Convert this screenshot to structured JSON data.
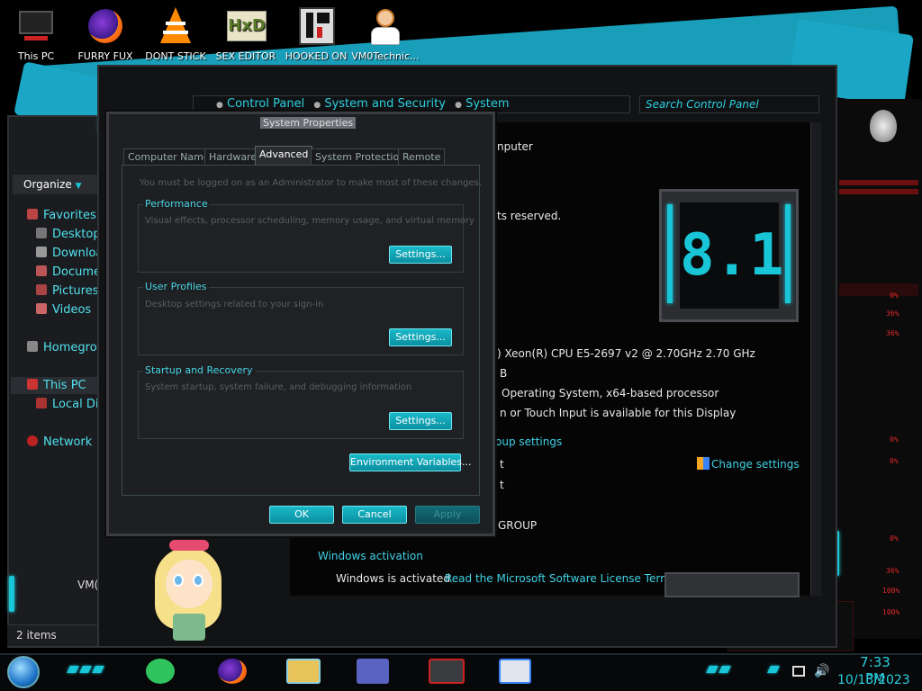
{
  "desktop_icons": [
    {
      "label": "This PC",
      "icon": "this-pc-icon"
    },
    {
      "label": "FURRY FUX",
      "icon": "firefox-icon"
    },
    {
      "label": "DONT STICK",
      "icon": "vlc-icon"
    },
    {
      "label": "SEX EDITOR",
      "icon": "hxd-icon"
    },
    {
      "label": "HOOKED ON",
      "icon": "hooked-on-icon"
    },
    {
      "label": "VM0Technic...",
      "icon": "doctor-avatar-icon"
    }
  ],
  "explorer": {
    "breadcrumb": [
      "Control Panel",
      "System and Security",
      "System"
    ],
    "search_placeholder": "Search Control Panel",
    "organize_label": "Organize",
    "nav": {
      "favorites": "Favorites",
      "desktop": "Desktop",
      "downloads": "Downloac",
      "documents": "Documer",
      "pictures": "Pictures",
      "videos": "Videos",
      "homegroup": "Homegroup",
      "this_pc": "This PC",
      "local_disk": "Local Dis",
      "network": "Network"
    },
    "status_items": "2 items",
    "vm_label": "VM("
  },
  "system_info": {
    "line_computer": "nputer",
    "line_rights": "ts reserved.",
    "windows_version": "8.1",
    "processor": ") Xeon(R) CPU E5-2697 v2 @ 2.70GHz   2.70 GHz",
    "memory_suffix": "B",
    "system_type": "Operating System, x64-based processor",
    "pen_touch": "n or Touch Input is available for this Display",
    "section_group": "oup settings",
    "change_settings": "Change settings",
    "row_t1": "t",
    "row_t2": "t",
    "workgroup": "GROUP",
    "activation_heading": "Windows activation",
    "activation_status": "Windows is activated",
    "license_link": "Read the Microsoft Software License Terms"
  },
  "dialog": {
    "title": "System Properties",
    "tabs": [
      "Computer Name",
      "Hardware",
      "Advanced",
      "System Protection",
      "Remote"
    ],
    "active_tab": "Advanced",
    "admin_note": "You must be logged on as an Administrator to make most of these changes.",
    "performance": {
      "title": "Performance",
      "desc": "Visual effects, processor scheduling, memory usage, and virtual memory",
      "button": "Settings..."
    },
    "user_profiles": {
      "title": "User Profiles",
      "desc": "Desktop settings related to your sign-in",
      "button": "Settings..."
    },
    "startup": {
      "title": "Startup and Recovery",
      "desc": "System startup, system failure, and debugging information",
      "button": "Settings..."
    },
    "env_button": "Environment Variables...",
    "ok": "OK",
    "cancel": "Cancel",
    "apply": "Apply"
  },
  "gadget_values": [
    "0%",
    "36%",
    "36%",
    "0%",
    "0%",
    "0%",
    "36%",
    "100%",
    "100%"
  ],
  "taskbar": {
    "time": "7:33 PM",
    "date": "10/13/2023",
    "apps": [
      "sticky-notes-icon",
      "firefox-icon",
      "file-explorer-icon",
      "control-panel-icon",
      "alienware-icon",
      "system-icon"
    ]
  },
  "colors": {
    "accent": "#18c6d8",
    "link": "#3fd2e6",
    "red": "#e0282a"
  }
}
